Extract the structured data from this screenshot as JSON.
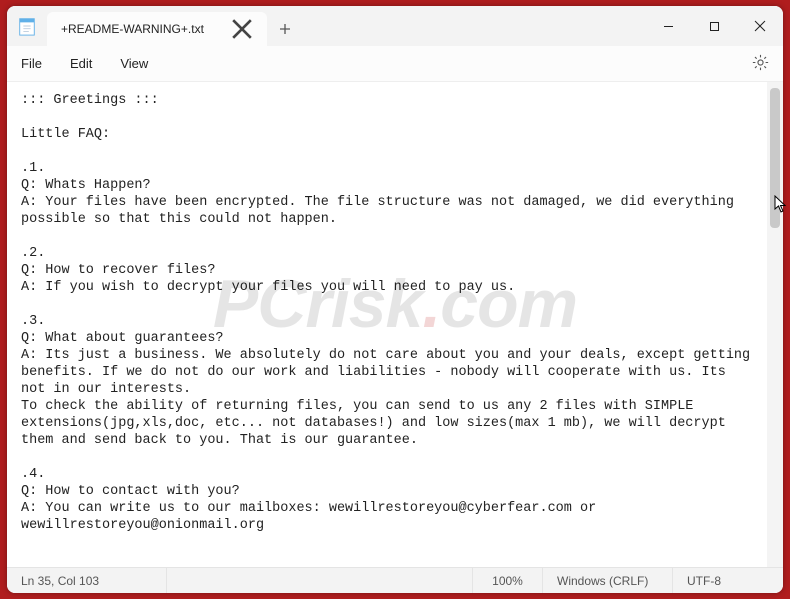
{
  "window": {
    "title": "+README-WARNING+.txt"
  },
  "tabs": {
    "active": {
      "title": "+README-WARNING+.txt"
    }
  },
  "menu": {
    "file": "File",
    "edit": "Edit",
    "view": "View"
  },
  "text": "::: Greetings :::\n\nLittle FAQ:\n\n.1.\nQ: Whats Happen?\nA: Your files have been encrypted. The file structure was not damaged, we did everything possible so that this could not happen.\n\n.2.\nQ: How to recover files?\nA: If you wish to decrypt your files you will need to pay us.\n\n.3.\nQ: What about guarantees?\nA: Its just a business. We absolutely do not care about you and your deals, except getting benefits. If we do not do our work and liabilities - nobody will cooperate with us. Its not in our interests.\nTo check the ability of returning files, you can send to us any 2 files with SIMPLE extensions(jpg,xls,doc, etc... not databases!) and low sizes(max 1 mb), we will decrypt them and send back to you. That is our guarantee.\n\n.4.\nQ: How to contact with you?\nA: You can write us to our mailboxes: wewillrestoreyou@cyberfear.com or wewillrestoreyou@onionmail.org",
  "status": {
    "cursor": "Ln 35, Col 103",
    "zoom": "100%",
    "lineendings": "Windows (CRLF)",
    "encoding": "UTF-8"
  },
  "watermark": {
    "a": "PCrisk",
    "b": "com"
  }
}
